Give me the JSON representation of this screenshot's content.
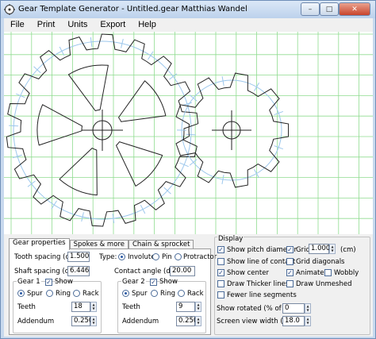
{
  "window": {
    "title": "Gear Template Generator - Untitled.gear    Matthias Wandel",
    "min_symbol": "–",
    "max_symbol": "□",
    "close_symbol": "✕"
  },
  "menu": [
    "File",
    "Print",
    "Units",
    "Export",
    "Help"
  ],
  "colors": {
    "grid": "#8fdc8f",
    "pitch": "#9cc7ec",
    "gear_line": "#222222"
  },
  "canvas": {
    "gears": [
      {
        "teeth": 18,
        "spokes": 5
      },
      {
        "teeth": 9,
        "spokes": 0
      }
    ]
  },
  "tabs": [
    "Gear properties",
    "Spokes & more",
    "Chain & sprocket"
  ],
  "gear_properties": {
    "tooth_spacing_label": "Tooth spacing (cm)",
    "tooth_spacing_value": "1.500",
    "type_label": "Type:",
    "type_options": [
      "Involute",
      "Pin",
      "Protractor"
    ],
    "type_selected": "Involute",
    "shaft_spacing_label": "Shaft spacing (cm)",
    "shaft_spacing_value": "6.446",
    "contact_angle_label": "Contact angle (deg)",
    "contact_angle_value": "20.00",
    "gear1": {
      "label": "Gear 1",
      "show_label": "Show",
      "show_checked": true,
      "kinds": [
        "Spur",
        "Ring",
        "Rack"
      ],
      "kind_selected": "Spur",
      "teeth_label": "Teeth",
      "teeth_value": "18",
      "addendum_label": "Addendum",
      "addendum_value": "0.250"
    },
    "gear2": {
      "label": "Gear 2",
      "show_label": "Show",
      "show_checked": true,
      "kinds": [
        "Spur",
        "Ring",
        "Rack"
      ],
      "kind_selected": "Spur",
      "teeth_label": "Teeth",
      "teeth_value": "9",
      "addendum_label": "Addendum",
      "addendum_value": "0.250"
    }
  },
  "display": {
    "label": "Display",
    "show_pitch_diameter": {
      "label": "Show pitch diameter",
      "checked": true
    },
    "grid": {
      "label": "Grid",
      "checked": true,
      "value": "1.000",
      "unit": "(cm)"
    },
    "show_line_of_contact": {
      "label": "Show line of contact",
      "checked": false
    },
    "grid_diagonals": {
      "label": "Grid diagonals",
      "checked": false
    },
    "show_center": {
      "label": "Show center",
      "checked": true
    },
    "animate": {
      "label": "Animate",
      "checked": true
    },
    "wobbly": {
      "label": "Wobbly",
      "checked": false
    },
    "draw_thicker_lines": {
      "label": "Draw Thicker lines",
      "checked": false
    },
    "draw_unmeshed": {
      "label": "Draw Unmeshed",
      "checked": false
    },
    "fewer_line_segments": {
      "label": "Fewer line segments",
      "checked": false
    },
    "show_rotated_label": "Show rotated (% of tooth)",
    "show_rotated_value": "0",
    "screen_view_width_label": "Screen view width (cm)",
    "screen_view_width_value": "18.0"
  }
}
